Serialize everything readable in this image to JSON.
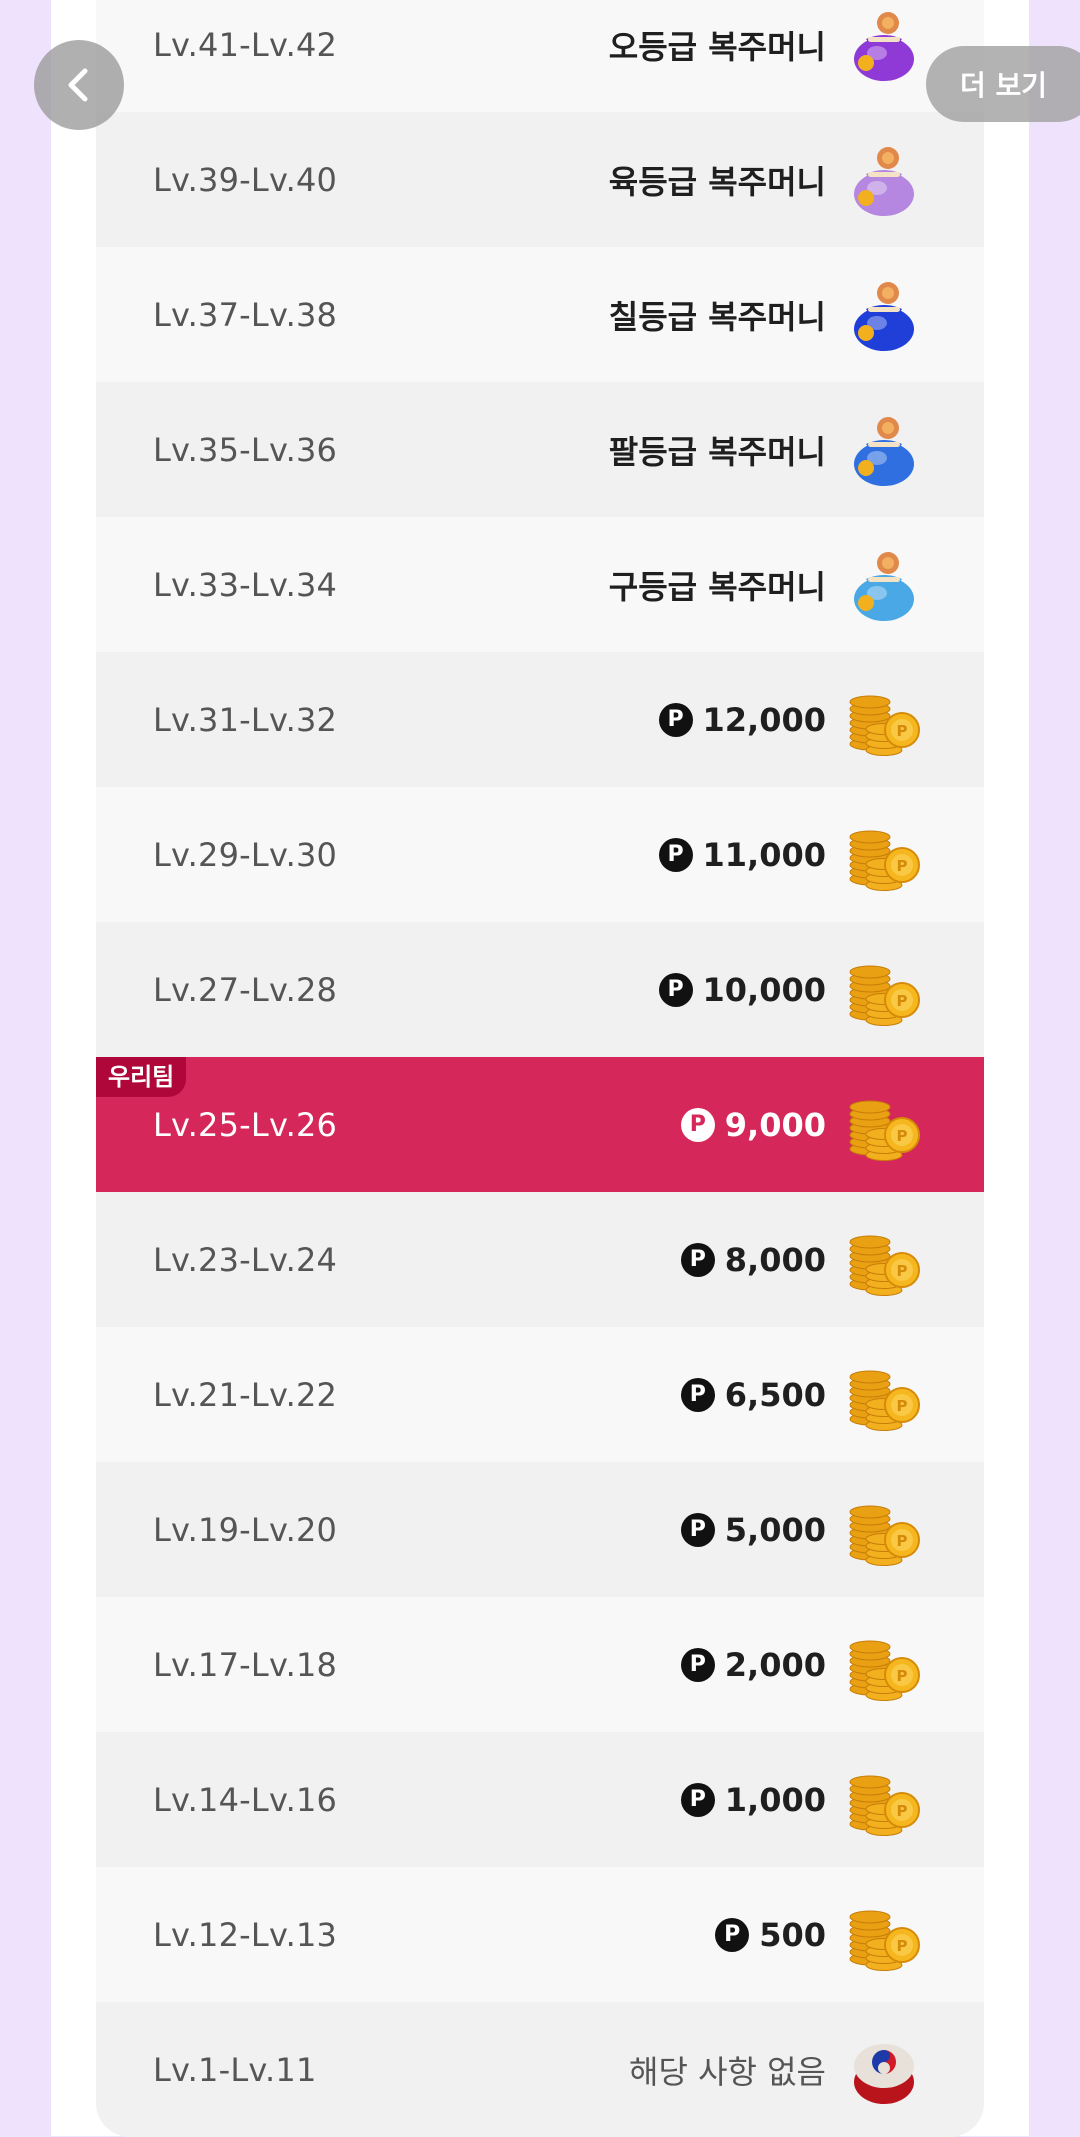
{
  "nav": {
    "more_label": "더 보기"
  },
  "team_tag": "우리팀",
  "rows": [
    {
      "level": "Lv.41-Lv.42",
      "reward": "오등급 복주머니",
      "type": "pouch",
      "color": "#8f3ad6",
      "shade": "light"
    },
    {
      "level": "Lv.39-Lv.40",
      "reward": "육등급 복주머니",
      "type": "pouch",
      "color": "#b687e0",
      "shade": "dark"
    },
    {
      "level": "Lv.37-Lv.38",
      "reward": "칠등급 복주머니",
      "type": "pouch",
      "color": "#1f3fd8",
      "shade": "light"
    },
    {
      "level": "Lv.35-Lv.36",
      "reward": "팔등급 복주머니",
      "type": "pouch",
      "color": "#2f6fe0",
      "shade": "dark"
    },
    {
      "level": "Lv.33-Lv.34",
      "reward": "구등급 복주머니",
      "type": "pouch",
      "color": "#4aa8e6",
      "shade": "light"
    },
    {
      "level": "Lv.31-Lv.32",
      "reward": "12,000",
      "type": "coins",
      "shade": "dark"
    },
    {
      "level": "Lv.29-Lv.30",
      "reward": "11,000",
      "type": "coins",
      "shade": "light"
    },
    {
      "level": "Lv.27-Lv.28",
      "reward": "10,000",
      "type": "coins",
      "shade": "dark"
    },
    {
      "level": "Lv.25-Lv.26",
      "reward": "9,000",
      "type": "coins",
      "shade": "highlight",
      "is_team": true
    },
    {
      "level": "Lv.23-Lv.24",
      "reward": "8,000",
      "type": "coins",
      "shade": "dark"
    },
    {
      "level": "Lv.21-Lv.22",
      "reward": "6,500",
      "type": "coins",
      "shade": "light"
    },
    {
      "level": "Lv.19-Lv.20",
      "reward": "5,000",
      "type": "coins",
      "shade": "dark"
    },
    {
      "level": "Lv.17-Lv.18",
      "reward": "2,000",
      "type": "coins",
      "shade": "light"
    },
    {
      "level": "Lv.14-Lv.16",
      "reward": "1,000",
      "type": "coins",
      "shade": "dark"
    },
    {
      "level": "Lv.12-Lv.13",
      "reward": "500",
      "type": "coins",
      "shade": "light"
    },
    {
      "level": "Lv.1-Lv.11",
      "reward": "해당 사항 없음",
      "type": "drum",
      "shade": "dark"
    }
  ],
  "colors": {
    "page_bg": "#efe2fc",
    "highlight": "#d52759",
    "team_tag": "#b0073a",
    "coin": "#f2b01e"
  },
  "icons": {
    "point_badge": "P",
    "back": "chevron-left-icon"
  }
}
